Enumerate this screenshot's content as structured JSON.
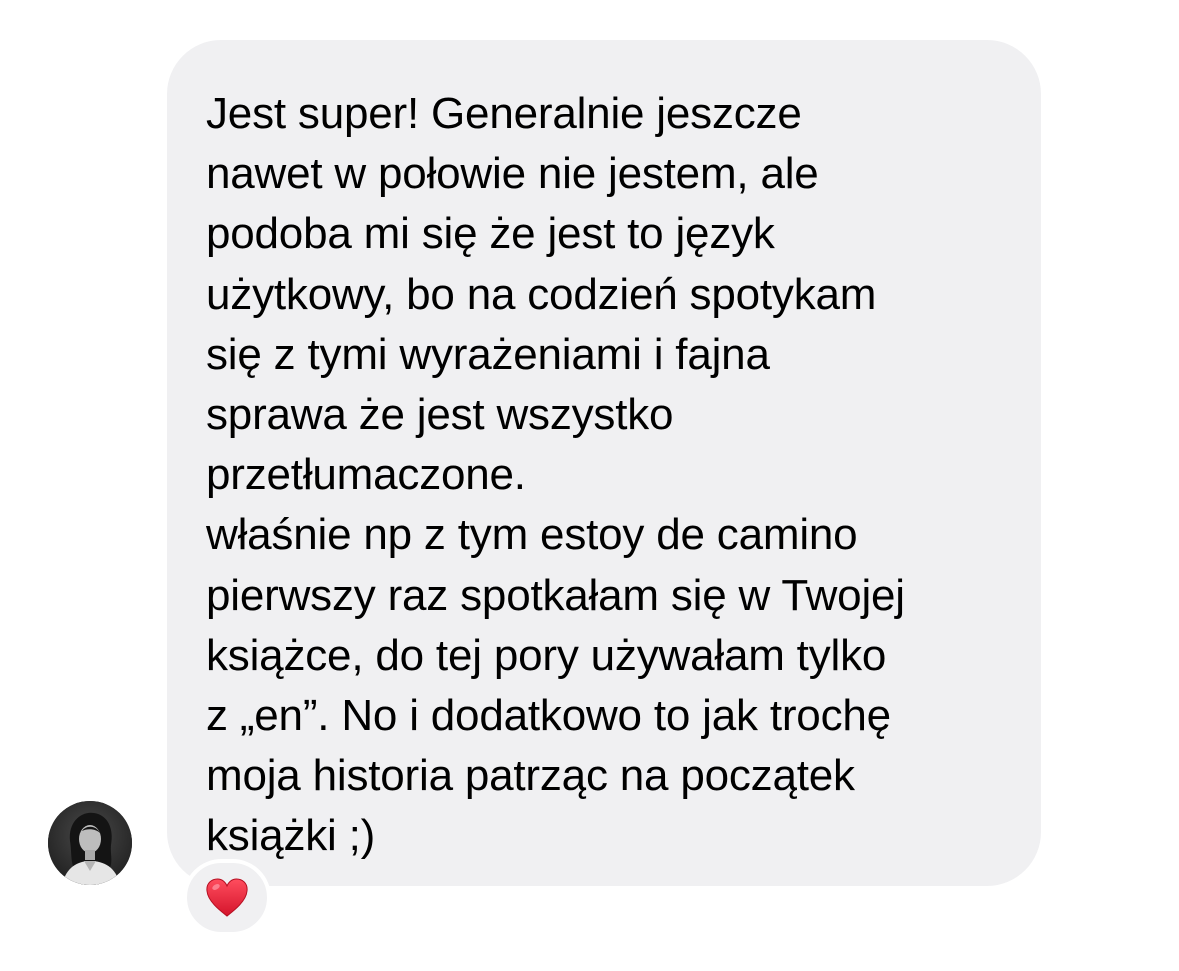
{
  "conversation": {
    "message": {
      "lines": [
        "Jest super! Generalnie jeszcze",
        "nawet w połowie nie jestem, ale",
        "podoba mi się że jest to język",
        "użytkowy, bo na codzień spotykam",
        "się z tymi wyrażeniami i fajna",
        "sprawa że jest wszystko",
        "przetłumaczone.",
        "właśnie np z tym estoy de camino",
        "pierwszy raz spotkałam się w Twojej",
        "książce, do tej pory używałam tylko",
        "z „en”. No i dodatkowo to jak trochę",
        "moja historia patrząc na początek",
        "książki ;)"
      ]
    },
    "sender": {
      "avatar_icon": "profile-photo"
    },
    "reaction": {
      "icon": "red-heart-icon",
      "color": "#e0245e"
    },
    "colors": {
      "bubble_background": "#f0f0f2",
      "text": "#000000",
      "page_background": "#ffffff"
    }
  }
}
